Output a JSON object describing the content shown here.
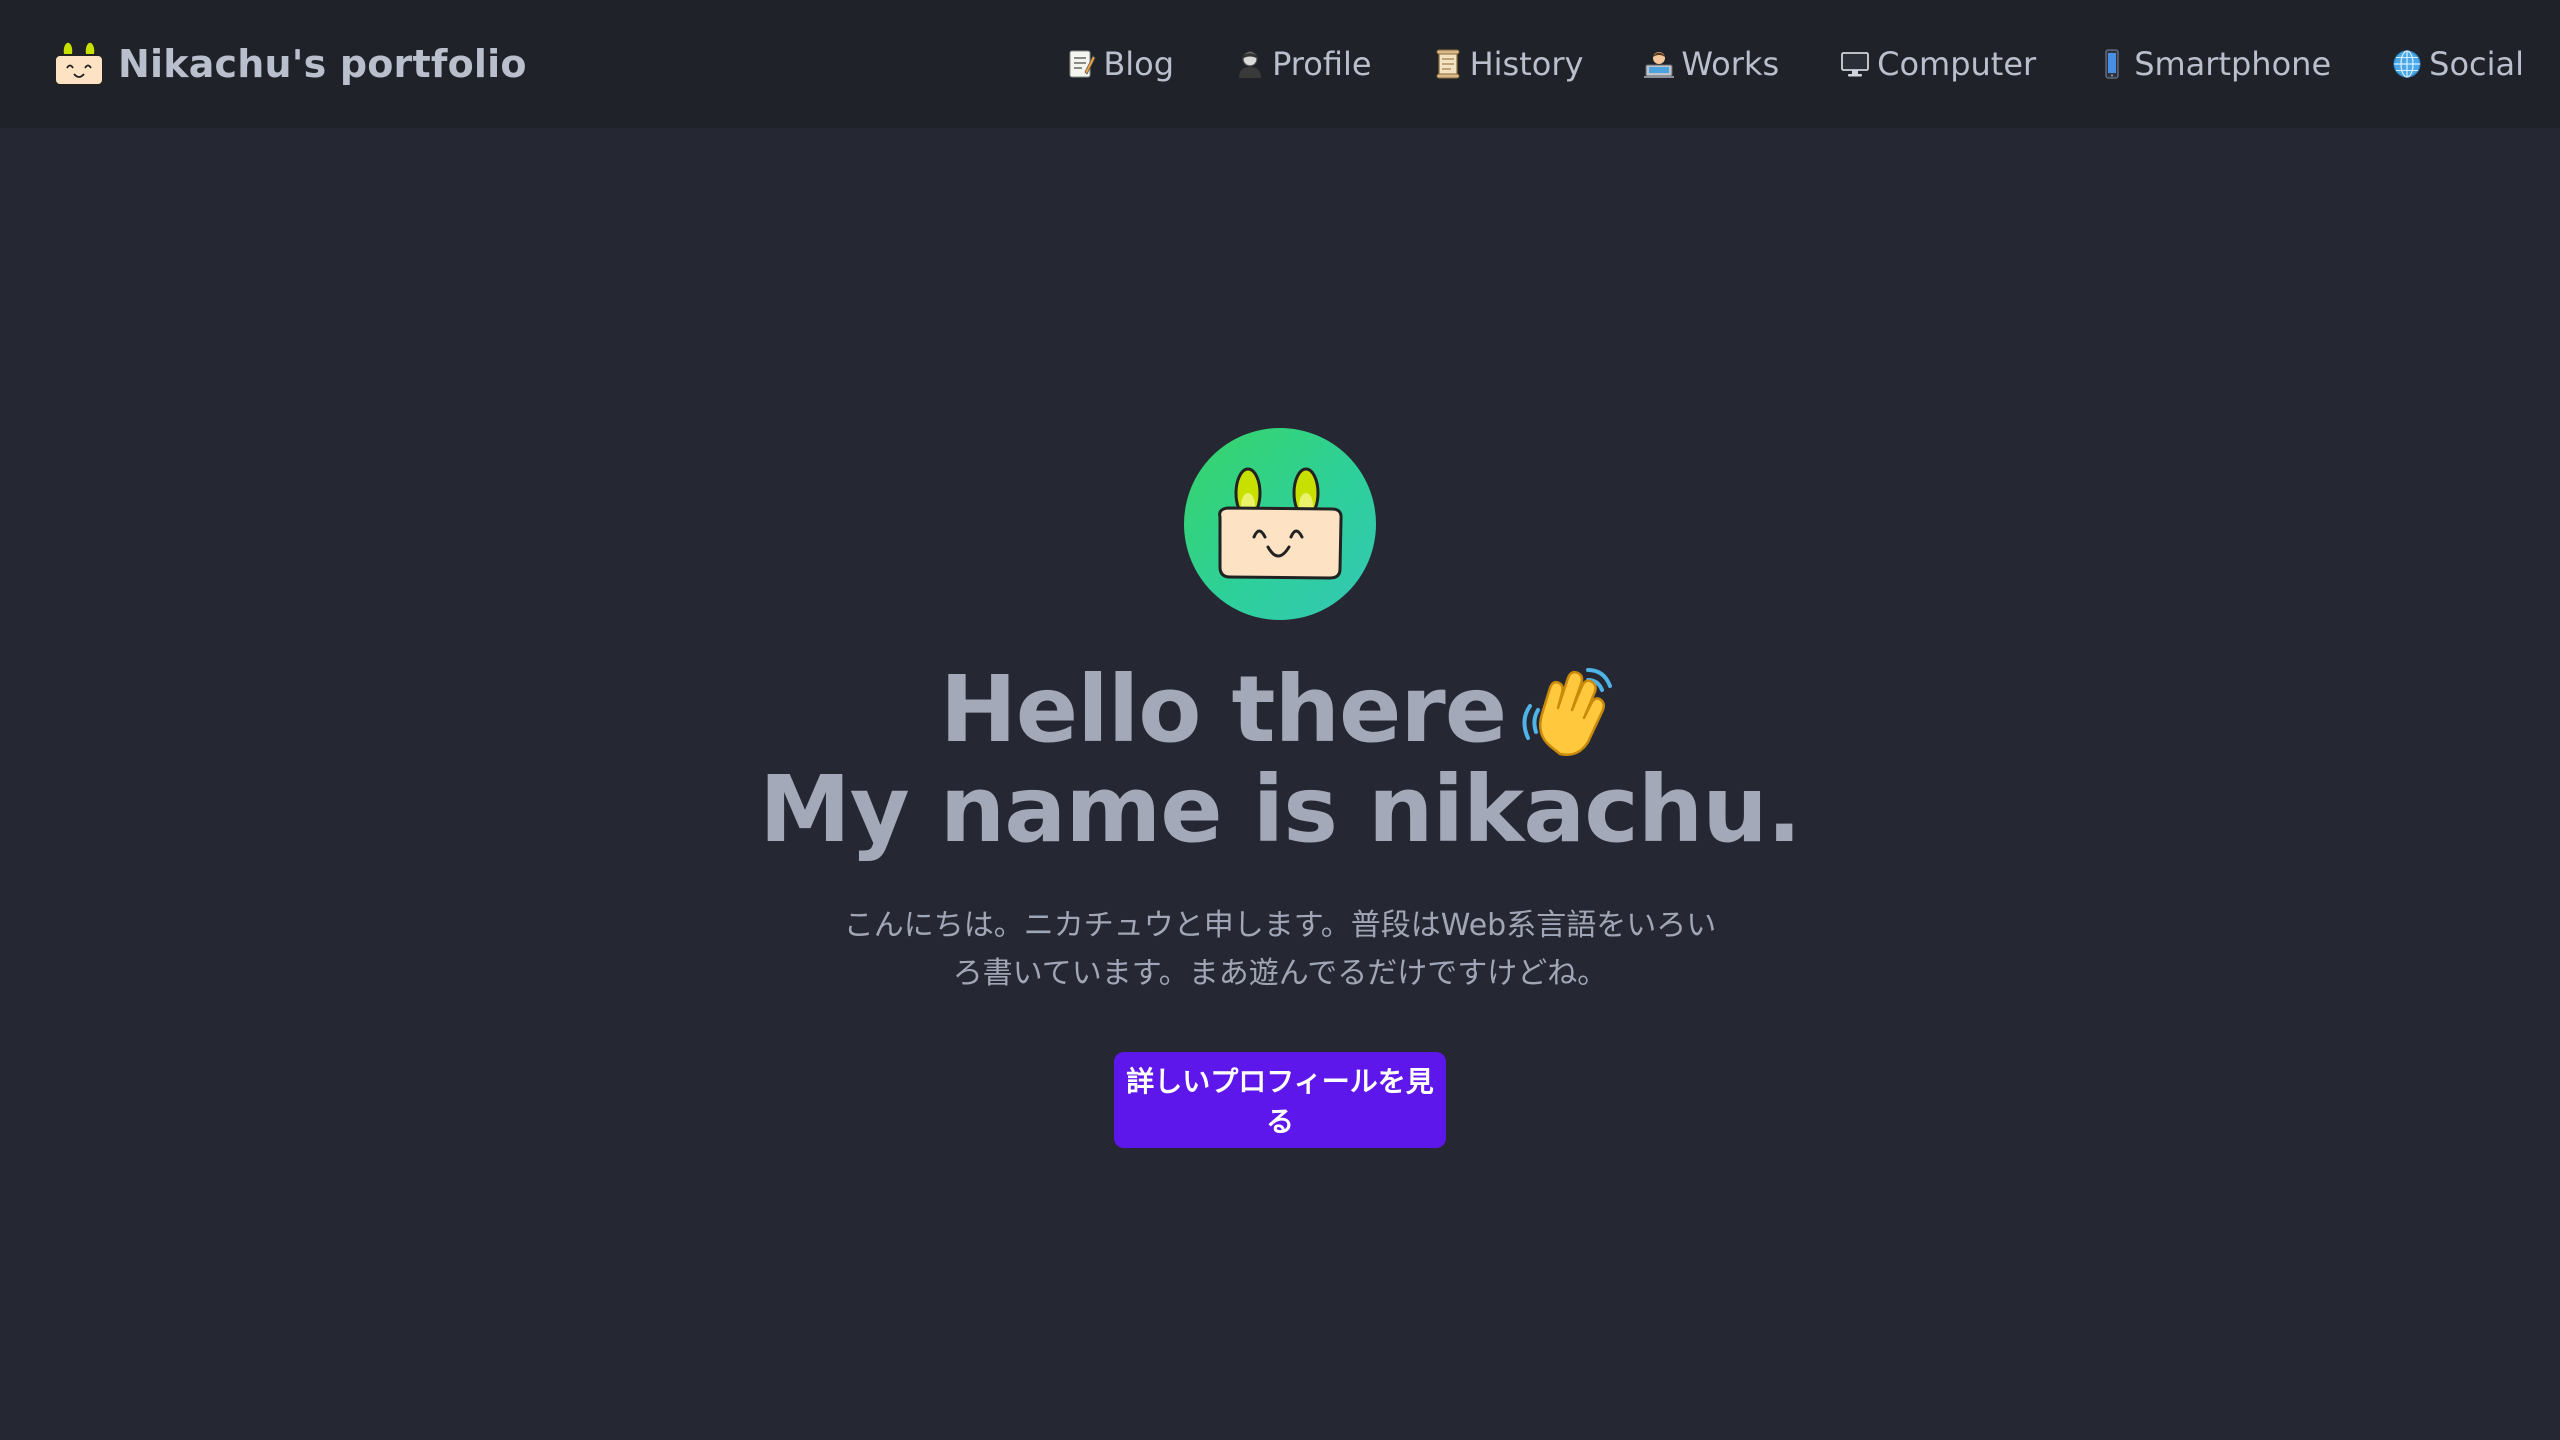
{
  "header": {
    "site_title": "Nikachu's portfolio",
    "logo_icon": "nikachu-logo-icon"
  },
  "nav": {
    "items": [
      {
        "label": "Blog",
        "icon": "memo-icon"
      },
      {
        "label": "Profile",
        "icon": "person-icon"
      },
      {
        "label": "History",
        "icon": "scroll-icon"
      },
      {
        "label": "Works",
        "icon": "technologist-icon"
      },
      {
        "label": "Computer",
        "icon": "desktop-computer-icon"
      },
      {
        "label": "Smartphone",
        "icon": "mobile-phone-icon"
      },
      {
        "label": "Social",
        "icon": "globe-icon"
      }
    ]
  },
  "hero": {
    "avatar_icon": "nikachu-avatar-icon",
    "headline_line1": "Hello there",
    "headline_line2": "My name is nikachu.",
    "wave_icon": "waving-hand-icon",
    "description": "こんにちは。ニカチュウと申します。普段はWeb系言語をいろいろ書いています。まあ遊んでるだけですけどね。",
    "cta_label": "詳しいプロフィールを見る"
  },
  "colors": {
    "background": "#252833",
    "navbar": "#1f2229",
    "accent": "#5e17eb",
    "avatar_gradient_start": "#38d466",
    "avatar_gradient_end": "#33c7b6"
  }
}
